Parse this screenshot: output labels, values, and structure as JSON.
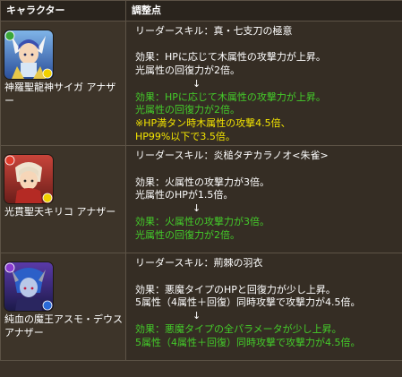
{
  "header": {
    "col_character": "キャラクター",
    "col_adjustment": "調整点"
  },
  "rows": [
    {
      "character": {
        "name": "神羅聖龍神サイガ アナザー",
        "portrait_icon": "saiga-another-portrait",
        "attribute_colors": [
          "#3aa63a",
          "#f0d000"
        ]
      },
      "leader_skill": "リーダースキル：真・七支刀の極意",
      "before": [
        "効果：HPに応じて木属性の攻撃力が上昇。",
        "光属性の回復力が2倍。"
      ],
      "arrow": "↓",
      "after": [
        "効果：HPに応じて木属性の攻撃力が上昇。",
        "光属性の回復力が2倍。"
      ],
      "extra": [
        "※HP満タン時木属性の攻撃4.5倍、",
        "HP99%以下で3.5倍。"
      ]
    },
    {
      "character": {
        "name": "光貫聖天キリコ アナザー",
        "portrait_icon": "kiriko-another-portrait",
        "attribute_colors": [
          "#e03a2a",
          "#f0d000"
        ]
      },
      "leader_skill": "リーダースキル：炎槌タヂカラノオ<朱雀>",
      "before": [
        "効果：火属性の攻撃力が3倍。",
        "光属性のHPが1.5倍。"
      ],
      "arrow": "↓",
      "after": [
        "効果：火属性の攻撃力が3倍。",
        "光属性の回復力が2倍。"
      ],
      "extra": []
    },
    {
      "character": {
        "name": "純血の魔王アスモ・デウス アナザー",
        "portrait_icon": "asmodeus-another-portrait",
        "attribute_colors": [
          "#8a3ad0",
          "#2a6ad8"
        ]
      },
      "leader_skill": "リーダースキル：荊棘の羽衣",
      "before": [
        "効果：悪魔タイプのHPと回復力が少し上昇。",
        "5属性（4属性＋回復）同時攻撃で攻撃力が4.5倍。"
      ],
      "arrow": "↓",
      "after": [
        "効果：悪魔タイプの全パラメータが少し上昇。",
        "5属性（4属性＋回復）同時攻撃で攻撃力が4.5倍。"
      ],
      "extra": []
    }
  ],
  "colors": {
    "after_text": "#44cc2a",
    "note_text": "#f2e400",
    "table_bg": "#352d24",
    "header_bg": "#2a241d"
  }
}
